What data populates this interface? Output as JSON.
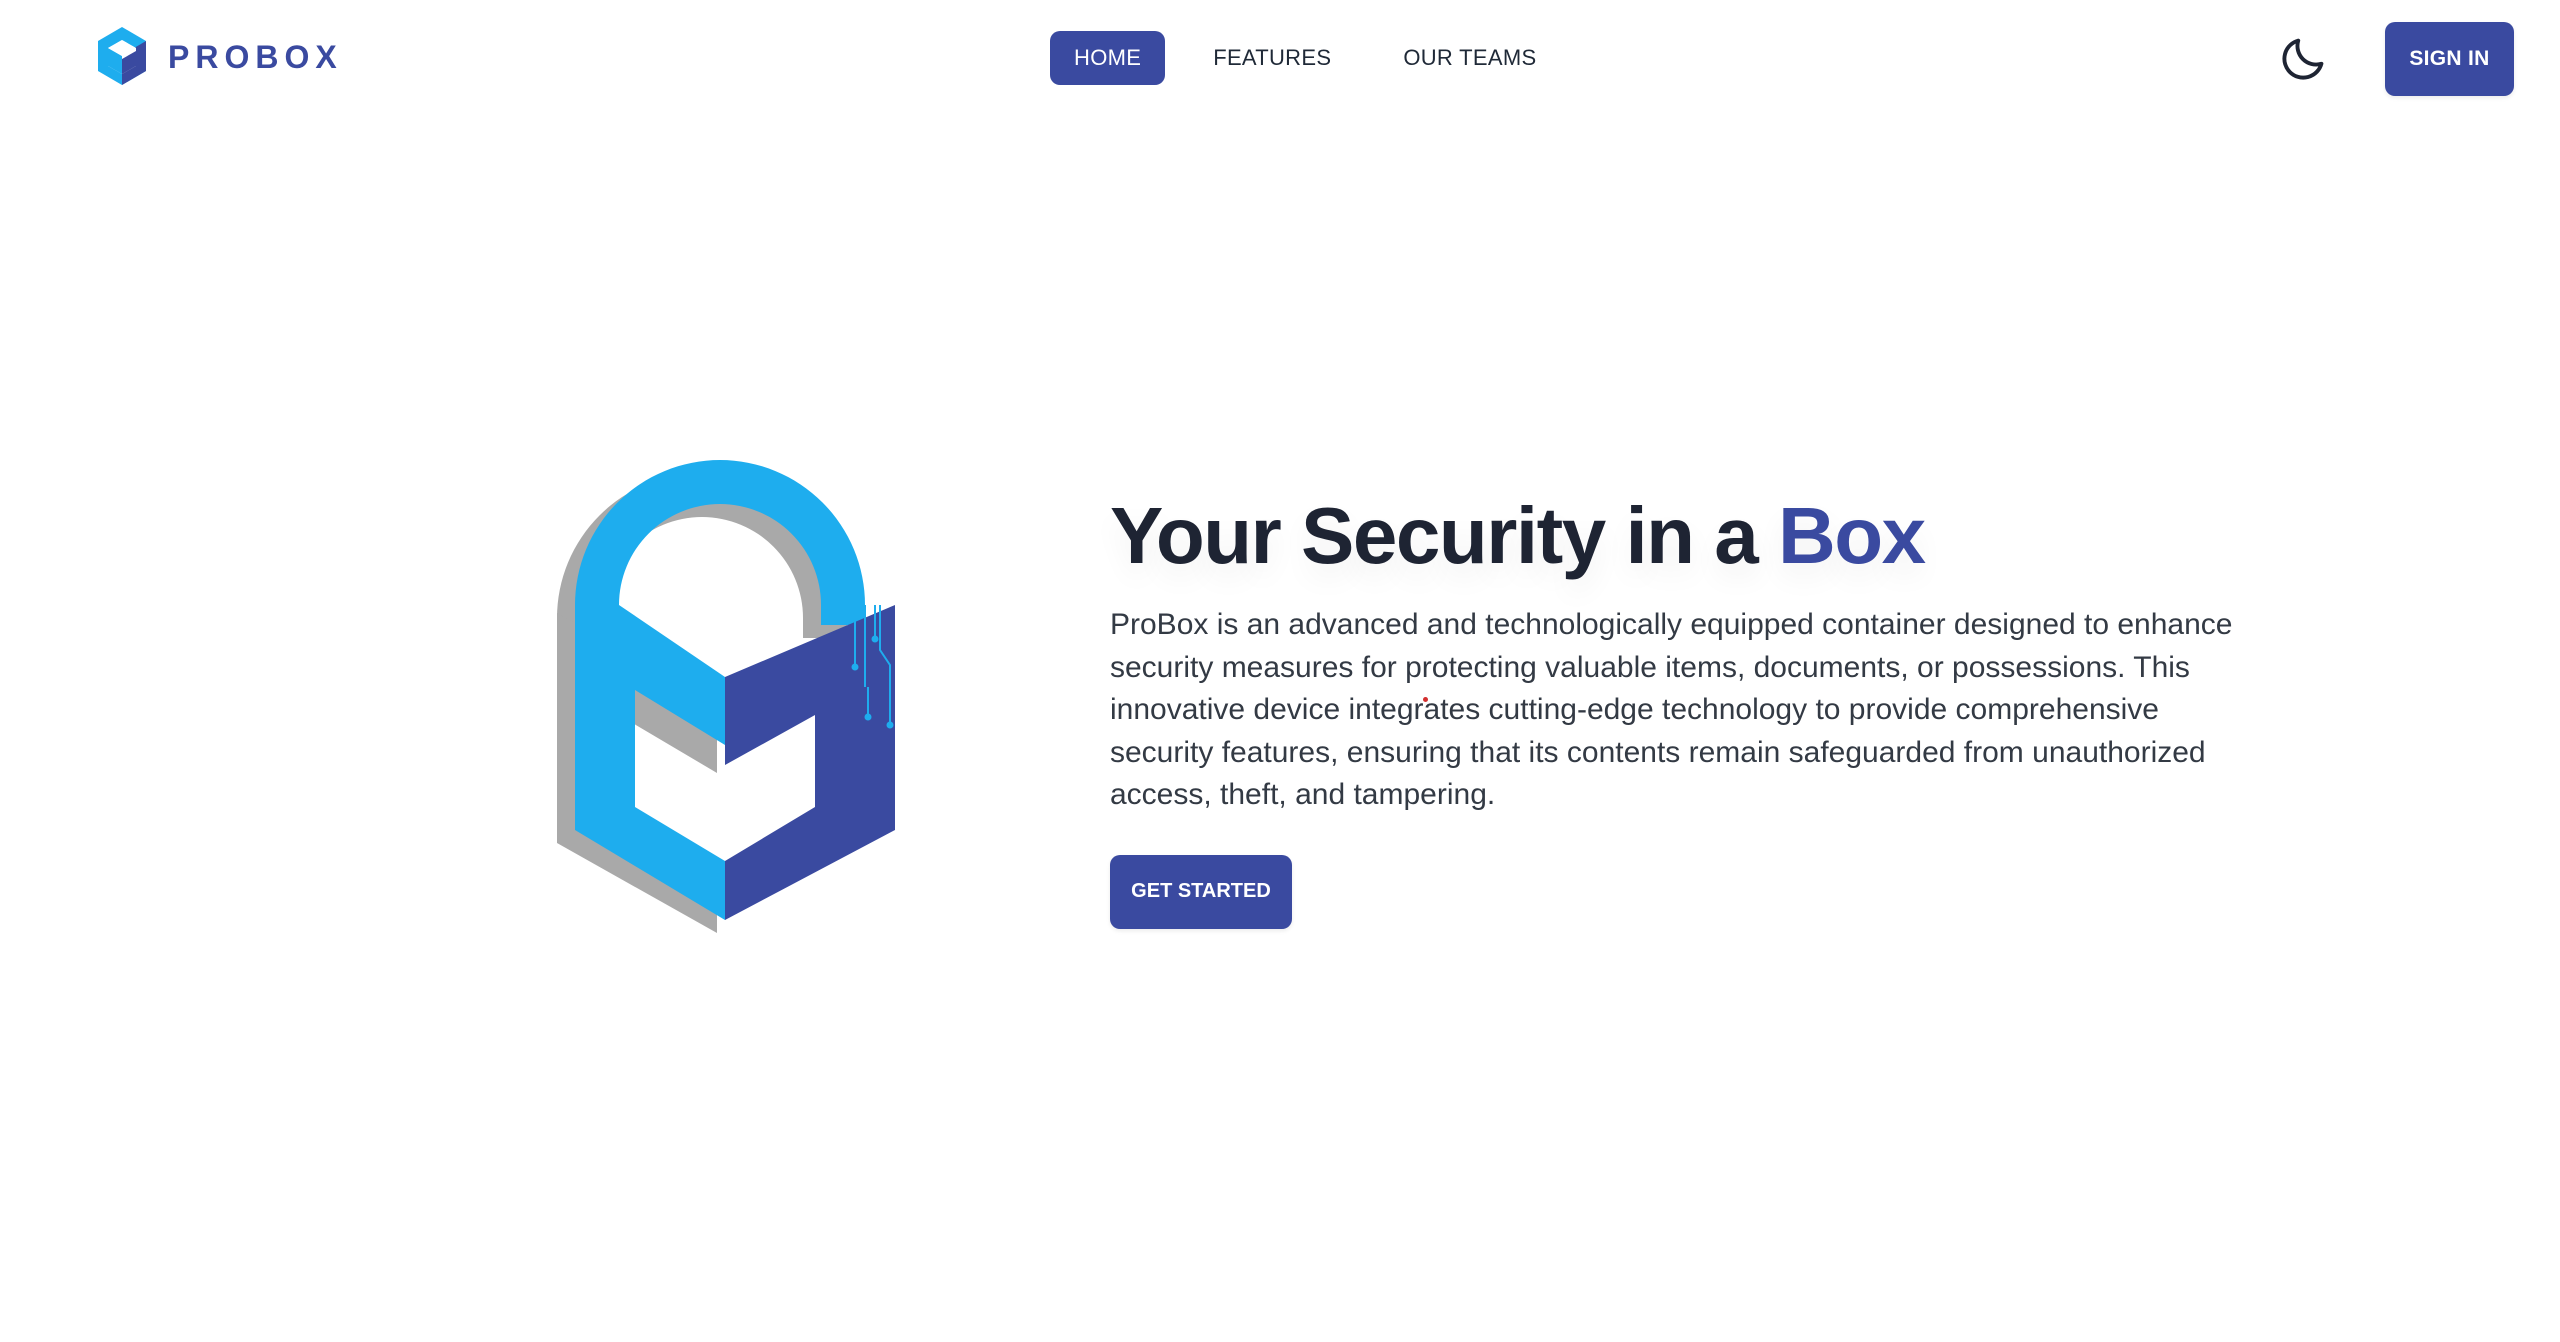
{
  "brand": {
    "name": "PROBOX",
    "logo_icon": "probox-box-logo-icon"
  },
  "nav": {
    "items": [
      {
        "label": "HOME",
        "active": true
      },
      {
        "label": "FEATURES",
        "active": false
      },
      {
        "label": "OUR TEAMS",
        "active": false
      }
    ]
  },
  "header": {
    "theme_toggle_icon": "moon-icon",
    "signin_label": "SIGN IN"
  },
  "hero": {
    "title_main": "Your Security in a",
    "title_accent": "Box",
    "description": "ProBox is an advanced and technologically equipped container designed to enhance security measures for protecting valuable items, documents, or possessions. This innovative device integrates cutting-edge technology to provide comprehensive security features, ensuring that its contents remain safeguarded from unauthorized access, theft, and tampering.",
    "cta_label": "GET STARTED",
    "illustration_icon": "padlock-box-icon"
  },
  "colors": {
    "primary": "#3a4aa0",
    "light_blue": "#1eadee",
    "text_dark": "#1e2433",
    "background": "#ffffff"
  }
}
